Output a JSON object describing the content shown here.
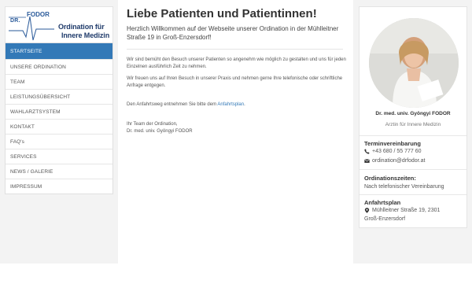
{
  "logo": {
    "dr": "DR.",
    "fodor": "FODOR",
    "line1": "Ordination für",
    "line2": "Innere Medizin"
  },
  "nav": [
    {
      "label": "STARTSEITE",
      "active": true
    },
    {
      "label": "UNSERE ORDINATION"
    },
    {
      "label": "TEAM"
    },
    {
      "label": "LEISTUNGSÜBERSICHT"
    },
    {
      "label": "WAHLARZTSYSTEM"
    },
    {
      "label": "KONTAKT"
    },
    {
      "label": "FAQ's"
    },
    {
      "label": "SERVICES"
    },
    {
      "label": "NEWS / GALERIE"
    },
    {
      "label": "IMPRESSUM"
    }
  ],
  "main": {
    "title": "Liebe Patienten und Patientinnen!",
    "intro": "Herzlich Willkommen auf der Webseite unserer Ordination in der Mühlleitner Straße 19 in Groß-Enzersdorf!",
    "p1": "Wir sind bemüht den Besuch unserer Patienten so angenehm wie möglich zu gestalten und uns für jeden Einzelnen ausführlich Zeit zu nehmen.",
    "p2": "Wir freuen uns auf Ihren Besuch in unserer Praxis und nehmen gerne Ihre telefonische oder schriftliche Anfrage entgegen.",
    "p3_prefix": "Den Anfahrtsweg entnehmen Sie bitte dem ",
    "p3_link": "Anfahrtsplan",
    "p3_suffix": ".",
    "sign1": "Ihr Team der Ordination,",
    "sign2": "Dr. med. univ. Gyöngyi FODOR"
  },
  "sidebar": {
    "name": "Dr. med. univ. Gyöngyi FODOR",
    "role": "Arztin für Innere Medizin",
    "appt_heading": "Terminvereinbarung",
    "phone": "+43 680 / 55 777 60",
    "email": "ordination@drfodor.at",
    "hours_heading": "Ordinationszeiten:",
    "hours_text": "Nach telefonischer Vereinbarung",
    "map_heading": "Anfahrtsplan",
    "address1": "Mühlleitner Straße 19, 2301",
    "address2": "Groß-Enzersdorf"
  },
  "colors": {
    "accent": "#3379b7",
    "background": "#f3f3f3"
  }
}
